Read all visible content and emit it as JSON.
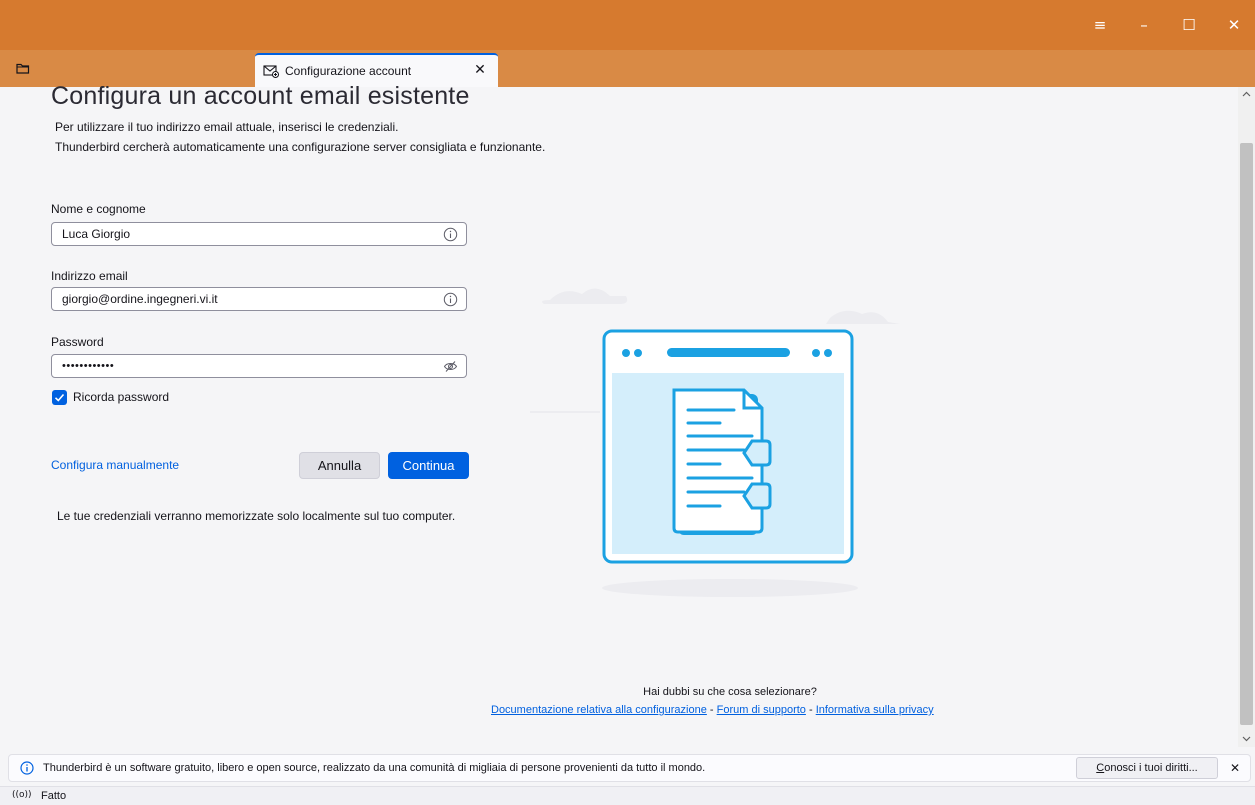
{
  "window": {
    "controls": {
      "menu": "≡",
      "minimize": "–",
      "maximize": "☐",
      "close": "✕"
    }
  },
  "tab": {
    "label": "Configurazione account",
    "close": "✕"
  },
  "form": {
    "title": "Configura un account email esistente",
    "intro_line1": "Per utilizzare il tuo indirizzo email attuale, inserisci le credenziali.",
    "intro_line2": "Thunderbird cercherà automaticamente una configurazione server consigliata e funzionante.",
    "name_label": "Nome e cognome",
    "name_value": "Luca Giorgio",
    "email_label": "Indirizzo email",
    "email_value": "giorgio@ordine.ingegneri.vi.it",
    "password_label": "Password",
    "password_value": "••••••••••••",
    "remember_label": "Ricorda password",
    "manual_link": "Configura manualmente",
    "cancel_label": "Annulla",
    "continue_label": "Continua",
    "note": "Le tue credenziali verranno memorizzate solo localmente sul tuo computer."
  },
  "help": {
    "question": "Hai dubbi su che cosa selezionare?",
    "link_docs": "Documentazione relativa alla configurazione",
    "sep1": " - ",
    "link_forum": "Forum di supporto",
    "sep2": " - ",
    "link_privacy": "Informativa sulla privacy"
  },
  "notification": {
    "text": "Thunderbird è un software gratuito, libero e open source, realizzato da una comunità di migliaia di persone provenienti da tutto il mondo.",
    "button_access_key": "C",
    "button_rest": "onosci i tuoi diritti...",
    "close": "✕"
  },
  "status": {
    "icon": "((o))",
    "text": "Fatto"
  },
  "colors": {
    "titlebar": "#d67a2f",
    "tabbar": "#d98a45",
    "accent": "#0061e0",
    "illustration": "#1ba1e2"
  }
}
